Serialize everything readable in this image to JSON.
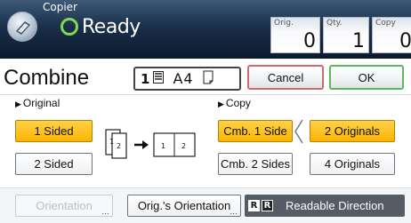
{
  "status_bar": {
    "app_name": "Copier",
    "status": "Ready",
    "counters": [
      {
        "label": "Orig.",
        "value": "0"
      },
      {
        "label": "Qty.",
        "value": "1"
      },
      {
        "label": "Copy",
        "value": "0"
      }
    ]
  },
  "screen": {
    "title": "Combine",
    "paper": {
      "tray": "1",
      "size": "A4"
    },
    "cancel_label": "Cancel",
    "ok_label": "OK"
  },
  "original": {
    "label": "Original",
    "options": [
      "1 Sided",
      "2 Sided"
    ],
    "selected": "1 Sided"
  },
  "diagram": {
    "left_pages": [
      "1",
      "2"
    ],
    "right_pages": [
      "1",
      "2"
    ]
  },
  "copy": {
    "label": "Copy",
    "side_options": [
      "Cmb. 1 Side",
      "Cmb. 2 Sides"
    ],
    "selected_side": "Cmb. 1 Side",
    "originals_options": [
      "2 Originals",
      "4 Originals"
    ],
    "selected_originals": "2 Originals"
  },
  "bottom": {
    "orientation_label": "Orientation",
    "orig_orientation_label": "Orig.'s Orientation",
    "readable_direction_label": "Readable Direction",
    "readable_glyph": "R"
  },
  "colors": {
    "selected": "#fbb400",
    "ready_indicator": "#7ed957",
    "cancel_border": "#d36a6a",
    "ok_border": "#5cb85c"
  }
}
